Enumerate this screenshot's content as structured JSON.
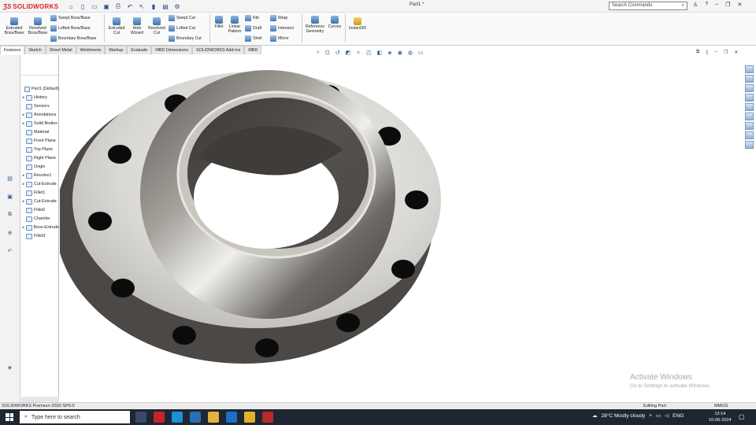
{
  "app": {
    "brand": "SOLIDWORKS",
    "doc_title": "Part1 *"
  },
  "search": {
    "placeholder": "Search Commands"
  },
  "ribbon": {
    "big": [
      "Extruded Boss/Base",
      "Revolved Boss/Base",
      "Extruded Cut",
      "Hole Wizard",
      "Revolved Cut",
      "Fillet",
      "Linear Pattern",
      "Reference Geometry",
      "Curves",
      "Instant3D"
    ],
    "small": [
      "Swept Boss/Base",
      "Lofted Boss/Base",
      "Boundary Boss/Base",
      "Swept Cut",
      "Lofted Cut",
      "Boundary Cut",
      "Rib",
      "Draft",
      "Shell",
      "Wrap",
      "Intersect",
      "Mirror"
    ]
  },
  "tabs": [
    "Features",
    "Sketch",
    "Sheet Metal",
    "Weldments",
    "Markup",
    "Evaluate",
    "MBD Dimensions",
    "SOLIDWORKS Add-Ins",
    "MBD"
  ],
  "tree": [
    {
      "label": "Part1  (Default)",
      "exp": ""
    },
    {
      "label": "History",
      "exp": "▸"
    },
    {
      "label": "Sensors",
      "exp": ""
    },
    {
      "label": "Annotations",
      "exp": "▸"
    },
    {
      "label": "Solid Bodies",
      "exp": "▸"
    },
    {
      "label": "Material",
      "exp": ""
    },
    {
      "label": "Front Plane",
      "exp": ""
    },
    {
      "label": "Top Plane",
      "exp": ""
    },
    {
      "label": "Right Plane",
      "exp": ""
    },
    {
      "label": "Origin",
      "exp": ""
    },
    {
      "label": "Revolve1",
      "exp": "▸"
    },
    {
      "label": "Cut-Extrude",
      "exp": "▸"
    },
    {
      "label": "Fillet1",
      "exp": ""
    },
    {
      "label": "Cut-Extrude",
      "exp": "▸"
    },
    {
      "label": "Fillet2",
      "exp": ""
    },
    {
      "label": "Chamfer",
      "exp": ""
    },
    {
      "label": "Boss-Extrude",
      "exp": "▸"
    },
    {
      "label": "Fillet3",
      "exp": ""
    }
  ],
  "watermark": {
    "title": "Activate Windows",
    "sub": "Go to Settings to activate Windows."
  },
  "status": {
    "left": "SOLIDWORKS Premium 2020 SP0.0",
    "mode": "Editing Part",
    "units": "MMGS"
  },
  "taskbar": {
    "search": "Type here to search",
    "weather": "28°C  Mostly cloudy",
    "lang": "ENG",
    "time": "13:14",
    "date": "10-06-2024"
  }
}
